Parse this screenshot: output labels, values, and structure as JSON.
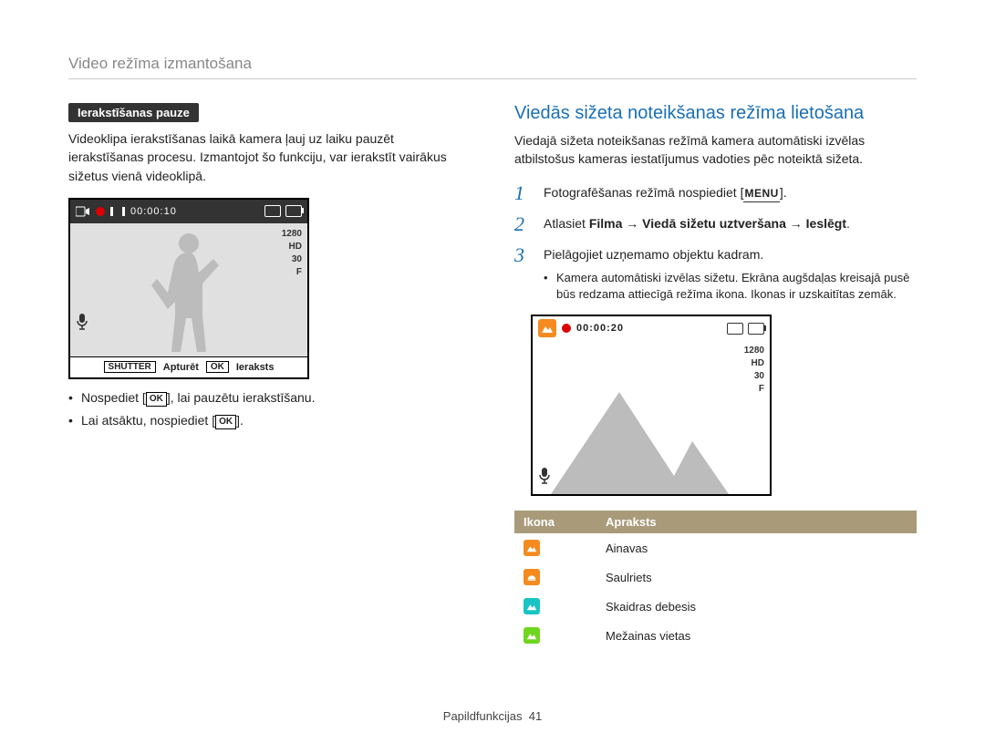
{
  "page_header": "Video režīma izmantošana",
  "pause_label": "Ierakstīšanas pauze",
  "pause_body": "Videoklipa ierakstīšanas laikā kamera ļauj uz laiku pauzēt ierakstīšanas procesu. Izmantojot šo funkciju, var ierakstīt vairākus sižetus vienā videoklipā.",
  "shot1": {
    "time": "00:00:10",
    "res": "1280",
    "hd": "HD",
    "fps": "30",
    "f": "F",
    "shutter_key": "SHUTTER",
    "stop": "Apturēt",
    "ok_key": "OK",
    "record": "Ieraksts"
  },
  "pause_bullets": {
    "b1a": "Nospediet [",
    "b1b": "], lai pauzētu ierakstīšanu.",
    "b1ok": "OK",
    "b2a": "Lai atsāktu, nospiediet [",
    "b2b": "].",
    "b2ok": "OK"
  },
  "right_title": "Viedās sižeta noteikšanas režīma lietošana",
  "right_body": "Viedajā sižeta noteikšanas režīmā kamera automātiski izvēlas atbilstošus kameras iestatījumus vadoties pēc noteiktā sižeta.",
  "steps": {
    "s1a": "Fotografēšanas režīmā nospiediet [",
    "s1b": "].",
    "menu": "MENU",
    "s2a": "Atlasiet ",
    "s2b": "Filma",
    "s2c": "Viedā sižetu uztveršana",
    "s2d": "Ieslēgt",
    "arrow": "→",
    "dot": ".",
    "s3": "Pielāgojiet uzņemamo objektu kadram.",
    "s3_sub": "Kamera automātiski izvēlas sižetu. Ekrāna augšdaļas kreisajā pusē būs redzama attiecīgā režīma ikona. Ikonas ir uzskaitītas zemāk."
  },
  "shot2": {
    "time": "00:00:20",
    "res": "1280",
    "hd": "HD",
    "fps": "30",
    "f": "F"
  },
  "table": {
    "h1": "Ikona",
    "h2": "Apraksts",
    "r1": "Ainavas",
    "r2": "Saulriets",
    "r3": "Skaidras debesis",
    "r4": "Mežainas vietas"
  },
  "footer_section": "Papildfunkcijas",
  "footer_page": "41"
}
